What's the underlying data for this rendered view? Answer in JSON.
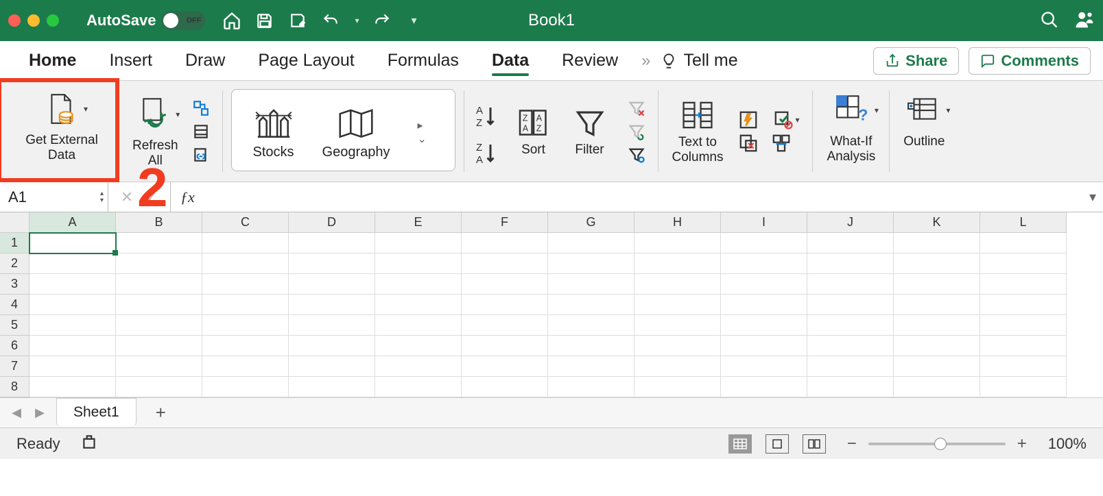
{
  "titlebar": {
    "autosave_label": "AutoSave",
    "autosave_state": "OFF",
    "title": "Book1"
  },
  "tabs": {
    "home": "Home",
    "insert": "Insert",
    "draw": "Draw",
    "pagelayout": "Page Layout",
    "formulas": "Formulas",
    "data": "Data",
    "review": "Review",
    "tellme": "Tell me"
  },
  "ribbon_buttons": {
    "share": "Share",
    "comments": "Comments"
  },
  "ribbon": {
    "get_external_data": "Get External\nData",
    "refresh_all": "Refresh\nAll",
    "stocks": "Stocks",
    "geography": "Geography",
    "sort": "Sort",
    "filter": "Filter",
    "text_to_columns": "Text to\nColumns",
    "whatif": "What-If\nAnalysis",
    "outline": "Outline"
  },
  "annotation": {
    "step": "2"
  },
  "formula_bar": {
    "name_box": "A1",
    "formula": ""
  },
  "columns": [
    "A",
    "B",
    "C",
    "D",
    "E",
    "F",
    "G",
    "H",
    "I",
    "J",
    "K",
    "L"
  ],
  "rows": [
    "1",
    "2",
    "3",
    "4",
    "5",
    "6",
    "7",
    "8"
  ],
  "active_cell": "A1",
  "sheet_tabs": {
    "sheet1": "Sheet1"
  },
  "status": {
    "ready": "Ready",
    "zoom": "100%"
  }
}
